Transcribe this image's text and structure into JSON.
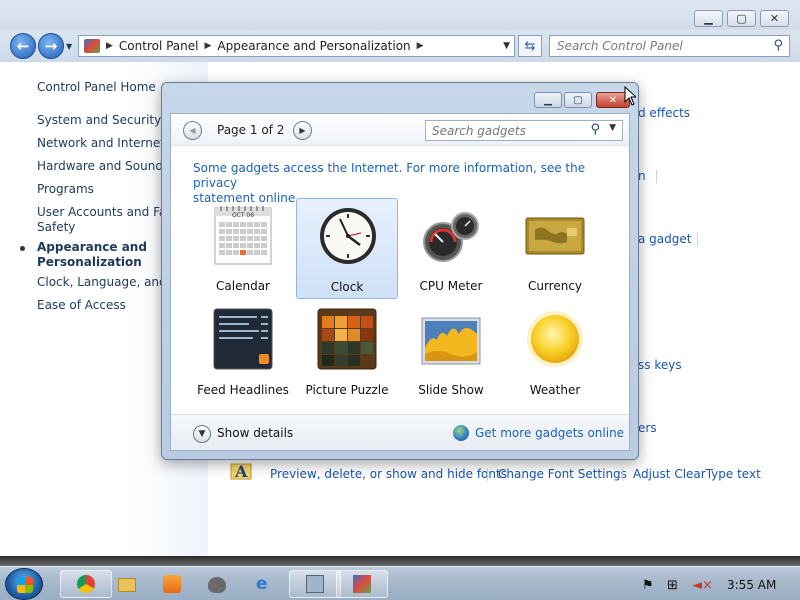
{
  "window_controls": {
    "minimize": "▁",
    "maximize": "▢",
    "close": "✕"
  },
  "address": {
    "crumbs": [
      "Control Panel",
      "Appearance and Personalization"
    ],
    "search_placeholder": "Search Control Panel"
  },
  "left_pane": {
    "home": "Control Panel Home",
    "items": [
      "System and Security",
      "Network and Internet",
      "Hardware and Sound",
      "Programs",
      "User Accounts and Family",
      "Safety",
      "Appearance and",
      "Personalization",
      "Clock, Language, and R",
      "Ease of Access"
    ]
  },
  "right_peek": {
    "effects": "d effects",
    "n": "n",
    "gadget": "a gadget",
    "keys": "ss keys",
    "ers": "ers",
    "fonts_links": [
      "Preview, delete, or show and hide fonts",
      "Change Font Settings",
      "Adjust ClearType text"
    ]
  },
  "gadgets_dialog": {
    "page_label": "Page 1 of 2",
    "search_placeholder": "Search gadgets",
    "info_line1": "Some gadgets access the Internet.  For more information, see the privacy",
    "info_line2": "statement online.",
    "gadgets": [
      "Calendar",
      "Clock",
      "CPU Meter",
      "Currency",
      "Feed Headlines",
      "Picture Puzzle",
      "Slide Show",
      "Weather"
    ],
    "selected": "Clock",
    "show_details": "Show details",
    "get_more": "Get more gadgets online",
    "calendar_month": "OCT 06"
  },
  "taskbar": {
    "time": "3:55 AM"
  },
  "colors": {
    "link": "#1a62b8",
    "nav": "#1e395b",
    "selection": "#cfe1f7"
  }
}
